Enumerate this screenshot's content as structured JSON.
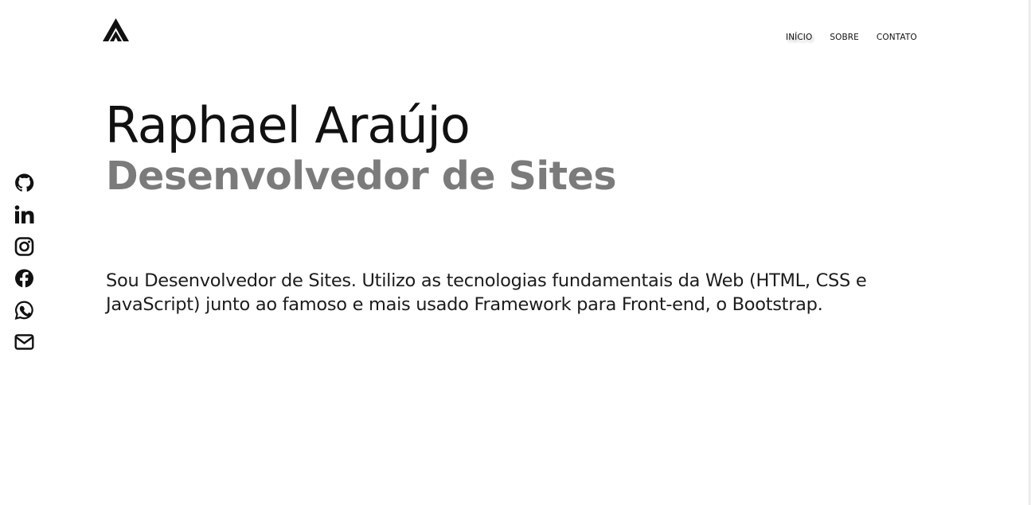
{
  "brand": {
    "logo_icon": "triangle-logo-icon"
  },
  "nav": {
    "items": [
      {
        "label": "INÍCIO",
        "active": true
      },
      {
        "label": "SOBRE",
        "active": false
      },
      {
        "label": "CONTATO",
        "active": false
      }
    ]
  },
  "hero": {
    "name": "Raphael Araújo",
    "role": "Desenvolvedor de Sites",
    "description": "Sou Desenvolvedor de Sites. Utilizo as tecnologias fundamentais da Web (HTML, CSS e JavaScript) junto ao famoso e mais usado Framework para Front-end, o Bootstrap."
  },
  "social": {
    "icons": [
      "github-icon",
      "linkedin-icon",
      "instagram-icon",
      "facebook-icon",
      "whatsapp-icon",
      "email-icon"
    ]
  },
  "colors": {
    "text": "#111111",
    "role": "#7b7b7b",
    "background": "#ffffff"
  }
}
